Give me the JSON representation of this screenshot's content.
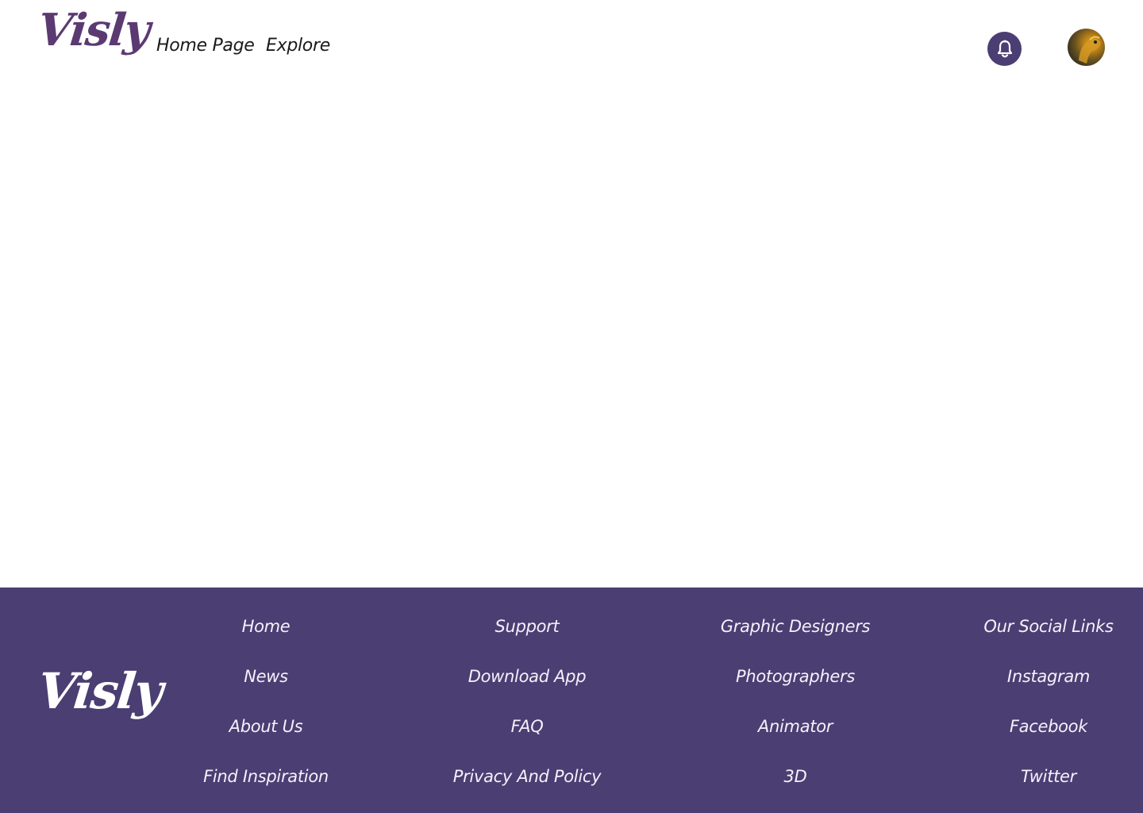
{
  "brand": {
    "logo_text": "Visly",
    "accent_color": "#4a3e72",
    "logo_color": "#5b3a72"
  },
  "nav": {
    "items": [
      {
        "label": "Home Page"
      },
      {
        "label": "Explore"
      }
    ]
  },
  "header": {
    "notification_icon": "bell-icon",
    "avatar_icon": "user-avatar"
  },
  "footer": {
    "logo_text": "Visly",
    "columns": [
      {
        "links": [
          "Home",
          "News",
          "About Us",
          "Find Inspiration"
        ]
      },
      {
        "links": [
          "Support",
          "Download App",
          "FAQ",
          "Privacy And Policy"
        ]
      },
      {
        "links": [
          "Graphic Designers",
          "Photographers",
          "Animator",
          "3D"
        ]
      },
      {
        "links": [
          "Our Social Links",
          "Instagram",
          "Facebook",
          "Twitter"
        ]
      }
    ]
  }
}
